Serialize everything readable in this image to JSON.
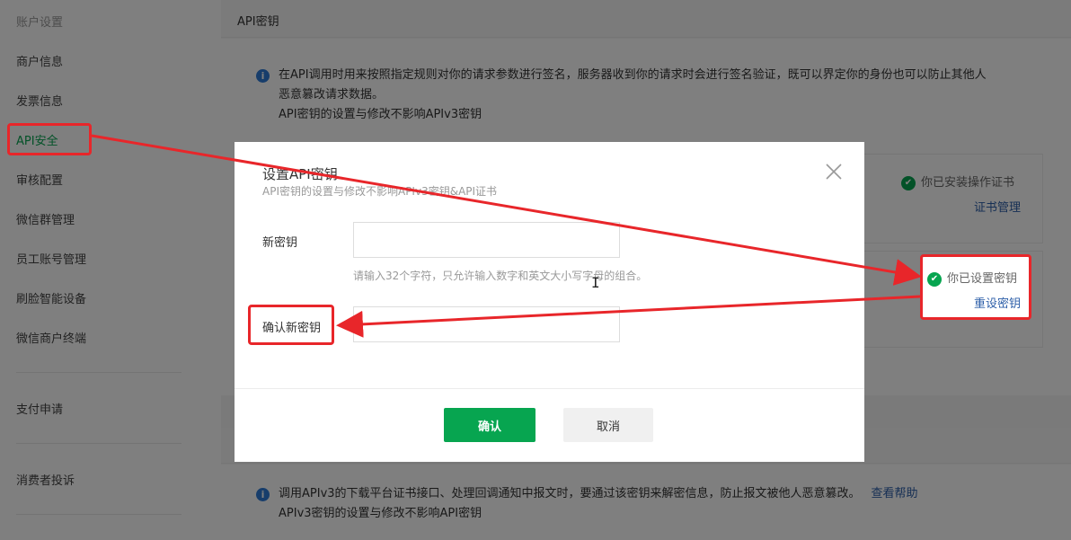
{
  "sidebar": {
    "items": [
      {
        "label": "账户设置"
      },
      {
        "label": "商户信息"
      },
      {
        "label": "发票信息"
      },
      {
        "label": "API安全"
      },
      {
        "label": "审核配置"
      },
      {
        "label": "微信群管理"
      },
      {
        "label": "员工账号管理"
      },
      {
        "label": "刷脸智能设备"
      },
      {
        "label": "微信商户终端"
      },
      {
        "label": "支付申请"
      },
      {
        "label": "消费者投诉"
      }
    ]
  },
  "main": {
    "section_title": "API密钥",
    "info_line1": "在API调用时用来按照指定规则对你的请求参数进行签名，服务器收到你的请求时会进行签名验证，既可以界定你的身份也可以防止其他人",
    "info_line2": "恶意篡改请求数据。",
    "info_line3": "API密钥的设置与修改不影响APIv3密钥",
    "cert_status": "你已安装操作证书",
    "cert_link": "证书管理",
    "key_status": "你已设置密钥",
    "key_link": "重设密钥",
    "v3_line1": "调用APIv3的下载平台证书接口、处理回调通知中报文时，要通过该密钥来解密信息，防止报文被他人恶意篡改。",
    "v3_help": "查看帮助",
    "v3_line2": "APIv3密钥的设置与修改不影响API密钥"
  },
  "dialog": {
    "title": "设置API密钥",
    "subtitle": "API密钥的设置与修改不影响APIv3密钥&API证书",
    "new_key_label": "新密钥",
    "new_key_value": "",
    "hint": "请输入32个字符，只允许输入数字和英文大小写字母的组合。",
    "confirm_label": "确认新密钥",
    "confirm_value": "",
    "ok_label": "确认",
    "cancel_label": "取消"
  },
  "colors": {
    "accent_green": "#07a550",
    "annotation_red": "#e8262a",
    "link_blue": "#2c5ea8",
    "info_blue": "#2f7bd6"
  }
}
